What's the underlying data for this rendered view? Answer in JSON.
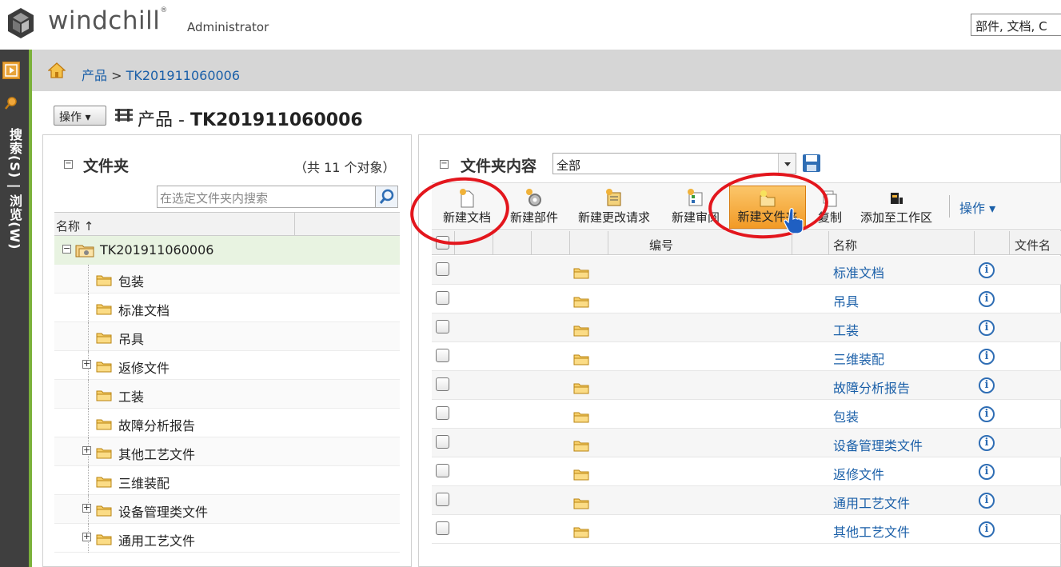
{
  "header": {
    "logo_text": "windchill",
    "user": "Administrator",
    "global_search_value": "部件, 文档, C"
  },
  "rail": {
    "vertical_text": "搜索(S) | 浏览(W)"
  },
  "breadcrumb": {
    "root": "产品",
    "separator": ">",
    "current": "TK201911060006"
  },
  "title": {
    "actions_label": "操作",
    "prefix": "产品 - ",
    "name": "TK201911060006"
  },
  "left_panel": {
    "heading": "文件夹",
    "count": "（共 11 个对象）",
    "search_placeholder": "在选定文件夹内搜索",
    "column_name": "名称 ↑",
    "root": "TK201911060006",
    "items": [
      {
        "label": "包装",
        "expandable": false
      },
      {
        "label": "标准文档",
        "expandable": false
      },
      {
        "label": "吊具",
        "expandable": false
      },
      {
        "label": "返修文件",
        "expandable": true
      },
      {
        "label": "工装",
        "expandable": false
      },
      {
        "label": "故障分析报告",
        "expandable": false
      },
      {
        "label": "其他工艺文件",
        "expandable": true
      },
      {
        "label": "三维装配",
        "expandable": false
      },
      {
        "label": "设备管理类文件",
        "expandable": true
      },
      {
        "label": "通用工艺文件",
        "expandable": true
      }
    ]
  },
  "right_panel": {
    "heading": "文件夹内容",
    "view_value": "全部",
    "toolbar": {
      "new_document": "新建文档",
      "new_part": "新建部件",
      "new_change_request": "新建更改请求",
      "new_review": "新建审阅",
      "new_folder": "新建文件夹",
      "copy": "复制",
      "add_to_workspace": "添加至工作区",
      "actions": "操作 ▾"
    },
    "columns": {
      "number": "编号",
      "name": "名称",
      "file_name": "文件名"
    },
    "rows": [
      "标准文档",
      "吊具",
      "工装",
      "三维装配",
      "故障分析报告",
      "包装",
      "设备管理类文件",
      "返修文件",
      "通用工艺文件",
      "其他工艺文件"
    ]
  },
  "colors": {
    "accent_link": "#1a5fa8",
    "highlight_button": "#f29a26",
    "annotation_red": "#e3161d",
    "rail_green": "#7bb13a"
  }
}
